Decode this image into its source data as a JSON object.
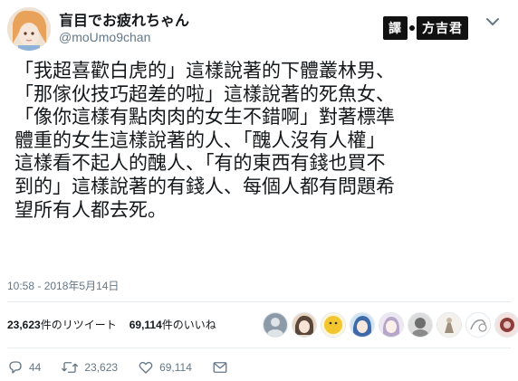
{
  "tweet": {
    "display_name": "盲目でお疲れちゃん",
    "handle": "@moUmo9chan",
    "lines": [
      "「我超喜歡白虎的」這樣說著的下體叢林男、",
      "「那傢伙技巧超差的啦」這樣說著的死魚女、",
      "「像你這樣有點肉肉的女生不錯啊」對著標準",
      "體重的女生這樣說著的人、「醜人沒有人權」",
      "這樣看不起人的醜人、「有的東西有錢也買不",
      "到的」這樣說著的有錢人、每個人都有問題希",
      "望所有人都去死。"
    ],
    "timestamp": "10:58 - 2018年5月14日"
  },
  "watermark": {
    "left": "譯",
    "right": "方吉君"
  },
  "stats": {
    "retweets_count": "23,623",
    "retweets_label": "件のリツイート",
    "likes_count": "69,114",
    "likes_label": "件のいいね"
  },
  "actions": {
    "reply_count": "44",
    "retweet_count": "23,623",
    "like_count": "69,114"
  },
  "colors": {
    "text": "#14171a",
    "muted": "#657786",
    "divider": "#e6ecf0"
  },
  "icons": [
    "chevron-down-icon",
    "reply-icon",
    "retweet-icon",
    "like-icon",
    "message-icon"
  ]
}
